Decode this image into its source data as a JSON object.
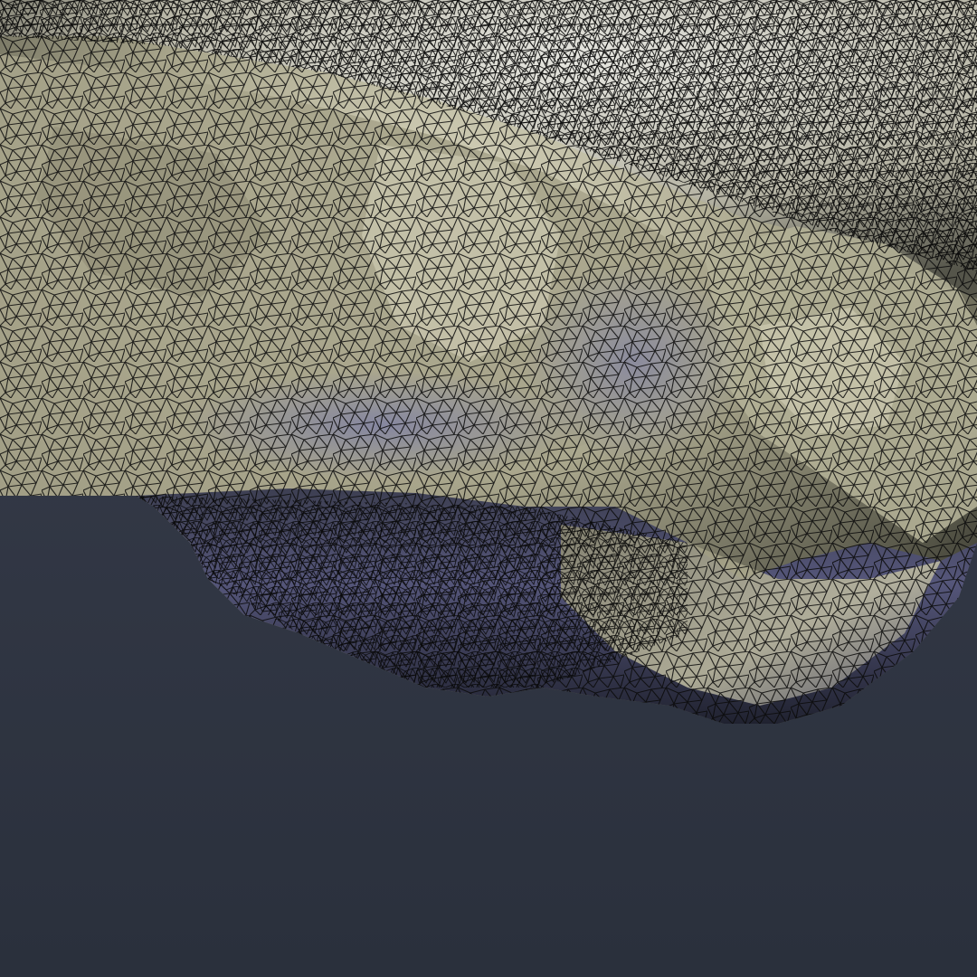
{
  "scene": {
    "subject": "rock-mesh-wireframe",
    "background": {
      "top": "#3a3f4e",
      "bottom": "#2a303c"
    },
    "mesh": {
      "light": "#d8d6bf",
      "mid": "#9d9a82",
      "dark": "#3f4036",
      "shadow_blue": "#5a5f9a",
      "wire": "#0a0a0a"
    },
    "wireframe_visible": true
  }
}
